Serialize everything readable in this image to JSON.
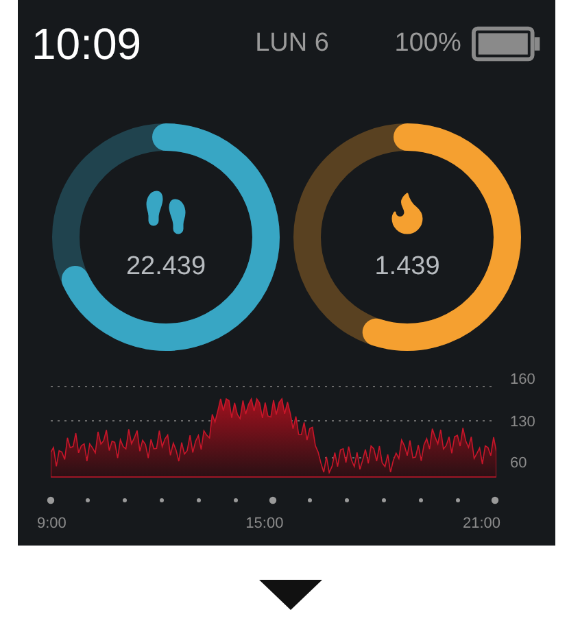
{
  "status_bar": {
    "time": "10:09",
    "date": "LUN 6",
    "battery": "100%"
  },
  "rings": [
    {
      "kind": "steps",
      "value": "22.439",
      "level": 0.68,
      "color": "#38a6c4"
    },
    {
      "kind": "calories",
      "value": "1.439",
      "level": 0.55,
      "color": "#f5a030"
    }
  ],
  "heart_rate": {
    "y_labels": [
      "160",
      "130",
      "60"
    ],
    "x_labels": [
      "9:00",
      "15:00",
      "21:00"
    ]
  }
}
